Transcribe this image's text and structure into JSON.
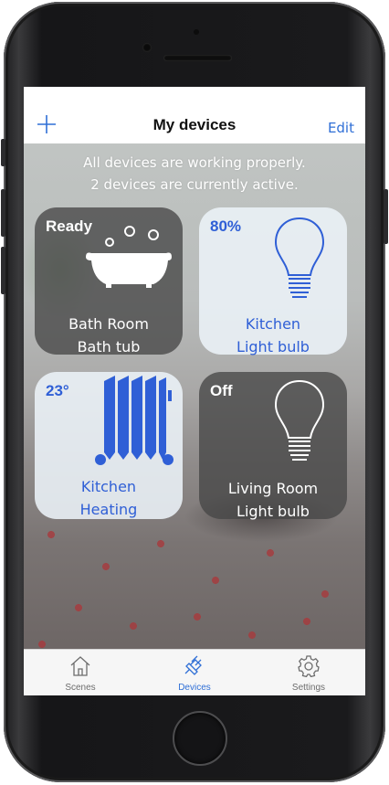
{
  "header": {
    "title": "My devices",
    "edit_label": "Edit",
    "add_icon": "plus-icon"
  },
  "status": {
    "line1": "All devices are working properly.",
    "line2": "2 devices are currently active."
  },
  "devices": [
    {
      "status": "Ready",
      "room": "Bath Room",
      "name": "Bath tub",
      "icon": "bathtub-icon",
      "theme": "dark"
    },
    {
      "status": "80%",
      "room": "Kitchen",
      "name": "Light bulb",
      "icon": "lightbulb-icon",
      "theme": "light"
    },
    {
      "status": "23°",
      "room": "Kitchen",
      "name": "Heating",
      "icon": "radiator-icon",
      "theme": "light"
    },
    {
      "status": "Off",
      "room": "Living Room",
      "name": "Light bulb",
      "icon": "lightbulb-icon",
      "theme": "dark"
    }
  ],
  "tabs": [
    {
      "label": "Scenes",
      "icon": "house-icon",
      "active": false
    },
    {
      "label": "Devices",
      "icon": "plug-icon",
      "active": true
    },
    {
      "label": "Settings",
      "icon": "gear-icon",
      "active": false
    }
  ],
  "colors": {
    "accent": "#2f6fd6",
    "dark_tile": "#464646",
    "light_tile": "#ecf2f8"
  }
}
